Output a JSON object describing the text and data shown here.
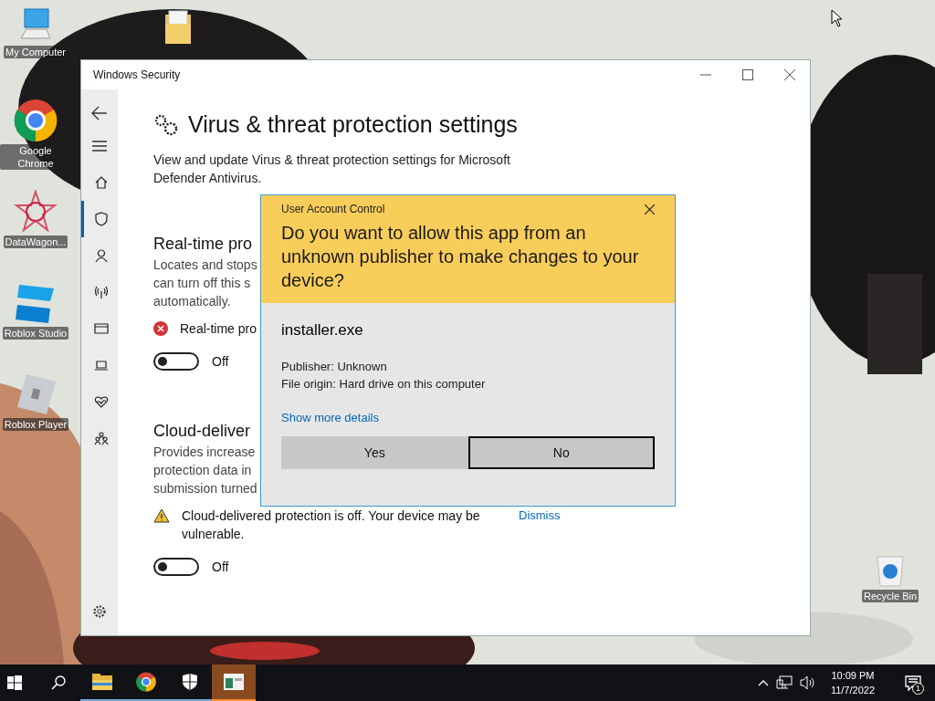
{
  "desktop_icons": [
    {
      "kind": "computer",
      "label": "My Computer"
    },
    {
      "kind": "chrome",
      "label": "Google Chrome"
    },
    {
      "kind": "star",
      "label": "DataWagon..."
    },
    {
      "kind": "studio",
      "label": "Roblox Studio"
    },
    {
      "kind": "player",
      "label": "Roblox Player"
    },
    {
      "kind": "folder"
    },
    {
      "kind": "recycle",
      "label": "Recycle Bin"
    }
  ],
  "window": {
    "title": "Windows Security",
    "page_title": "Virus & threat protection settings",
    "description": "View and update Virus & threat protection settings for Microsoft Defender Antivirus.",
    "nav": [
      {
        "kind": "home",
        "selected": false
      },
      {
        "kind": "shield",
        "selected": true
      },
      {
        "kind": "person",
        "selected": false
      },
      {
        "kind": "wifi",
        "selected": false
      },
      {
        "kind": "browser",
        "selected": false
      },
      {
        "kind": "laptop",
        "selected": false
      },
      {
        "kind": "heart",
        "selected": false
      },
      {
        "kind": "family",
        "selected": false
      }
    ],
    "sections": [
      {
        "heading": "Real-time pro",
        "description_lines": [
          "Locates and stops",
          "can turn off this s",
          "automatically."
        ],
        "status": {
          "kind": "error",
          "text": "Real-time pro"
        },
        "toggle": {
          "on": false,
          "label": "Off"
        }
      },
      {
        "heading": "Cloud-deliver",
        "description_lines": [
          "Provides increase",
          "protection data in",
          "submission turned"
        ],
        "status": {
          "kind": "warning",
          "text": "Cloud-delivered protection is off. Your device may be vulnerable.",
          "link": "Dismiss"
        },
        "toggle": {
          "on": false,
          "label": "Off"
        }
      }
    ]
  },
  "uac": {
    "title": "User Account Control",
    "question": "Do you want to allow this app from an unknown publisher to make changes to your device?",
    "program": "installer.exe",
    "publisher": "Publisher: Unknown",
    "origin": "File origin: Hard drive on this computer",
    "details_link": "Show more details",
    "buttons": [
      {
        "label": "Yes",
        "selected": false
      },
      {
        "label": "No",
        "selected": true
      }
    ]
  },
  "taskbar": {
    "apps": [
      {
        "kind": "folder",
        "active": false
      },
      {
        "kind": "chrome",
        "active": false
      },
      {
        "kind": "shield",
        "active": false
      },
      {
        "kind": "app",
        "active": true
      }
    ],
    "time": "10:09 PM",
    "date": "11/7/2022",
    "notifications": "1"
  }
}
